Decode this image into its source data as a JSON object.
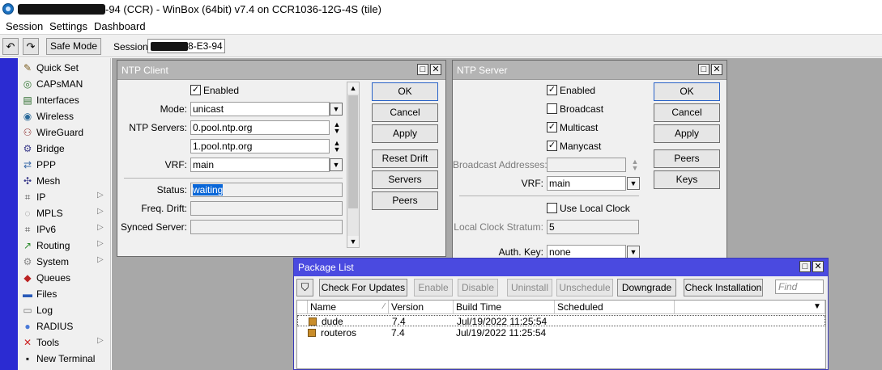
{
  "window": {
    "title": "-94 (CCR) - WinBox (64bit) v7.4 on CCR1036-12G-4S (tile)"
  },
  "menu": [
    "Session",
    "Settings",
    "Dashboard"
  ],
  "toolbar": {
    "undo_icon": "undo-icon",
    "redo_icon": "redo-icon",
    "safe_mode": "Safe Mode",
    "session_label": "Session:",
    "session_value": "8-E3-94"
  },
  "sidebar": {
    "accent_color": "#2b2bd2",
    "items": [
      {
        "label": "Quick Set",
        "icon": "quick-set-icon",
        "submenu": false
      },
      {
        "label": "CAPsMAN",
        "icon": "capsman-icon",
        "submenu": false
      },
      {
        "label": "Interfaces",
        "icon": "interfaces-icon",
        "submenu": false
      },
      {
        "label": "Wireless",
        "icon": "wireless-icon",
        "submenu": false
      },
      {
        "label": "WireGuard",
        "icon": "wireguard-icon",
        "submenu": false
      },
      {
        "label": "Bridge",
        "icon": "bridge-icon",
        "submenu": false
      },
      {
        "label": "PPP",
        "icon": "ppp-icon",
        "submenu": false
      },
      {
        "label": "Mesh",
        "icon": "mesh-icon",
        "submenu": false
      },
      {
        "label": "IP",
        "icon": "ip-icon",
        "submenu": true
      },
      {
        "label": "MPLS",
        "icon": "mpls-icon",
        "submenu": true
      },
      {
        "label": "IPv6",
        "icon": "ipv6-icon",
        "submenu": true
      },
      {
        "label": "Routing",
        "icon": "routing-icon",
        "submenu": true
      },
      {
        "label": "System",
        "icon": "system-icon",
        "submenu": true
      },
      {
        "label": "Queues",
        "icon": "queues-icon",
        "submenu": false
      },
      {
        "label": "Files",
        "icon": "files-icon",
        "submenu": false
      },
      {
        "label": "Log",
        "icon": "log-icon",
        "submenu": false
      },
      {
        "label": "RADIUS",
        "icon": "radius-icon",
        "submenu": false
      },
      {
        "label": "Tools",
        "icon": "tools-icon",
        "submenu": true
      },
      {
        "label": "New Terminal",
        "icon": "terminal-icon",
        "submenu": false
      }
    ]
  },
  "ntp_client": {
    "title": "NTP Client",
    "enabled_label": "Enabled",
    "enabled": true,
    "mode_label": "Mode:",
    "mode_value": "unicast",
    "servers_label": "NTP Servers:",
    "servers": [
      "0.pool.ntp.org",
      "1.pool.ntp.org"
    ],
    "vrf_label": "VRF:",
    "vrf_value": "main",
    "status_label": "Status:",
    "status_value": "waiting",
    "freq_drift_label": "Freq. Drift:",
    "freq_drift_value": "",
    "synced_server_label": "Synced Server:",
    "synced_server_value": "",
    "buttons": {
      "ok": "OK",
      "cancel": "Cancel",
      "apply": "Apply",
      "reset_drift": "Reset Drift",
      "servers": "Servers",
      "peers": "Peers"
    }
  },
  "ntp_server": {
    "title": "NTP Server",
    "enabled_label": "Enabled",
    "enabled": true,
    "broadcast_label": "Broadcast",
    "broadcast": false,
    "multicast_label": "Multicast",
    "multicast": true,
    "manycast_label": "Manycast",
    "manycast": true,
    "broadcast_addresses_label": "Broadcast Addresses:",
    "broadcast_addresses_value": "",
    "vrf_label": "VRF:",
    "vrf_value": "main",
    "use_local_clock_label": "Use Local Clock",
    "use_local_clock": false,
    "local_clock_stratum_label": "Local Clock Stratum:",
    "local_clock_stratum_value": "5",
    "auth_key_label": "Auth. Key:",
    "auth_key_value": "none",
    "buttons": {
      "ok": "OK",
      "cancel": "Cancel",
      "apply": "Apply",
      "peers": "Peers",
      "keys": "Keys"
    }
  },
  "package_list": {
    "title": "Package List",
    "title_color": "#4a4ae0",
    "buttons": {
      "check_for_updates": "Check For Updates",
      "enable": "Enable",
      "disable": "Disable",
      "uninstall": "Uninstall",
      "unschedule": "Unschedule",
      "downgrade": "Downgrade",
      "check_installation": "Check Installation"
    },
    "find_placeholder": "Find",
    "columns": [
      "Name",
      "Version",
      "Build Time",
      "Scheduled"
    ],
    "rows": [
      {
        "name": "dude",
        "version": "7.4",
        "build_time": "Jul/19/2022 11:25:54",
        "scheduled": ""
      },
      {
        "name": "routeros",
        "version": "7.4",
        "build_time": "Jul/19/2022 11:25:54",
        "scheduled": ""
      }
    ]
  }
}
